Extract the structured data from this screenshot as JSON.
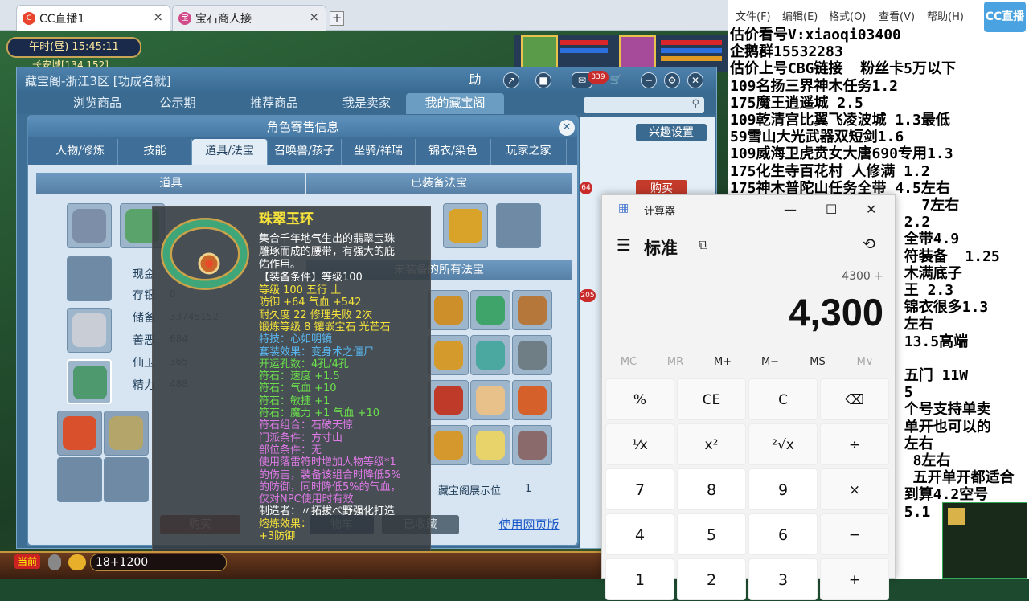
{
  "browser": {
    "tabs": [
      {
        "label": "CC直播1",
        "icon": "cc-icon"
      },
      {
        "label": "宝石商人接",
        "icon": "game-icon"
      }
    ],
    "new_tab": "+",
    "close": "×"
  },
  "game": {
    "clock": "午时(昼)  15:45:11",
    "location": "长安城[134,152]",
    "mail_count": "339",
    "bottom_left": "当前",
    "chat_value": "18+1200"
  },
  "cbg": {
    "title": "藏宝阁-浙江3区 [功成名就]",
    "title_buttons": [
      "助"
    ],
    "nav": [
      "浏览商品",
      "公示期",
      "推荐商品",
      "我是卖家",
      "我的藏宝阁"
    ],
    "active_nav": 4,
    "interest_settings": "兴趣设置",
    "buy": "购买",
    "badges": [
      "64",
      "205"
    ]
  },
  "role_panel": {
    "title": "角色寄售信息",
    "tabs": [
      "人物/修炼",
      "技能",
      "道具/法宝",
      "召唤兽/孩子",
      "坐骑/祥瑞",
      "锦衣/染色",
      "玩家之家"
    ],
    "active_tab": 2,
    "items_header": "道具",
    "equipped_header": "已装备法宝",
    "unequipped_header": "未装备的所有法宝",
    "stats": [
      {
        "label": "现金",
        "value": ""
      },
      {
        "label": "存银",
        "value": "0"
      },
      {
        "label": "储备",
        "value": "33745152"
      },
      {
        "label": "善恶",
        "value": "684"
      },
      {
        "label": "仙玉",
        "value": "365"
      },
      {
        "label": "精力",
        "value": "488"
      }
    ],
    "display_label": "藏宝阁展示位",
    "display_value": "1",
    "buy_button": "购买",
    "fav_button": "物车",
    "collected_button": "已收藏",
    "web_version_link": "使用网页版"
  },
  "tooltip": {
    "name": "珠翠玉环",
    "desc": [
      "集合千年地气生出的翡翠宝珠",
      "雕琢而成的腰带，有强大的庇",
      "佑作用。"
    ],
    "req": "【装备条件】等级100",
    "lines": [
      {
        "text": "等级 100  五行 土",
        "color": "#f5e23a"
      },
      {
        "text": "防御 +64 气血 +542",
        "color": "#f5e23a"
      },
      {
        "text": "耐久度 22  修理失败 2次",
        "color": "#f5e23a"
      },
      {
        "text": "锻炼等级 8  镶嵌宝石 光芒石",
        "color": "#f5e23a"
      },
      {
        "text": "特技：心如明镜",
        "color": "#58b6f0"
      },
      {
        "text": "套装效果：变身术之僵尸",
        "color": "#58b6f0"
      },
      {
        "text": "开运孔数：4孔/4孔",
        "color": "#6be04c"
      },
      {
        "text": "符石：速度 +1.5",
        "color": "#6be04c"
      },
      {
        "text": "符石：气血 +10",
        "color": "#6be04c"
      },
      {
        "text": "符石：敏捷 +1",
        "color": "#6be04c"
      },
      {
        "text": "符石：魔力 +1 气血 +10",
        "color": "#6be04c"
      },
      {
        "text": "符石组合：石破天惊",
        "color": "#e07ae8"
      },
      {
        "text": "门派条件：方寸山",
        "color": "#e07ae8"
      },
      {
        "text": "部位条件：无",
        "color": "#e07ae8"
      },
      {
        "text": "使用落雷符时增加人物等级*1",
        "color": "#e07ae8"
      },
      {
        "text": "的伤害，装备该组合时降低5%",
        "color": "#e07ae8"
      },
      {
        "text": "的防御，同时降低5%的气血，",
        "color": "#e07ae8"
      },
      {
        "text": "仅对NPC使用时有效",
        "color": "#e07ae8"
      },
      {
        "text": "制造者：〃拓拔ぺ野强化打造",
        "color": "#ffffff"
      },
      {
        "text": "熔炼效果：",
        "color": "#f5e23a"
      },
      {
        "text": "+3防御",
        "color": "#f5e23a"
      }
    ]
  },
  "notepad": {
    "menu": [
      "文件(F)",
      "编辑(E)",
      "格式(O)",
      "查看(V)",
      "帮助(H)"
    ],
    "lines": [
      "估价看号V:xiaoqi03400",
      "企鹅群15532283",
      "估价上号CBG链接  粉丝卡5万以下",
      "109名扬三界神木任务1.2",
      "175魔王逍遥城 2.5",
      "109乾清宫比翼飞凌波城 1.3最低",
      "59雪山大光武器双短剑1.6",
      "109威海卫虎贲女大唐690专用1.3",
      "175化生寺百花村 人修满 1.2",
      "175神木普陀山任务全带 4.5左右",
      "                      7左右",
      "                    2.2",
      "                    全带4.9",
      "                    符装备  1.25",
      "                    木满底子",
      "                    王 2.3",
      "                    锦衣很多1.3",
      "                    左右",
      "                    13.5高端",
      "",
      "                    五门 11W",
      "                    5",
      "                    个号支持单卖",
      "                    单开也可以的",
      "                    左右",
      "                     8左右",
      "                     五开单开都适合",
      "                    到算4.2空号",
      "                    5.1"
    ],
    "logo": "CC直播"
  },
  "calculator": {
    "title": "计算器",
    "mode": "标准",
    "expression": "4300 +",
    "display": "4,300",
    "memory": [
      "MC",
      "MR",
      "M+",
      "M−",
      "MS",
      "M∨"
    ],
    "keys": [
      [
        "%",
        "CE",
        "C",
        "⌫"
      ],
      [
        "¹⁄x",
        "x²",
        "²√x",
        "÷"
      ],
      [
        "7",
        "8",
        "9",
        "×"
      ],
      [
        "4",
        "5",
        "6",
        "−"
      ],
      [
        "1",
        "2",
        "3",
        "+"
      ]
    ]
  }
}
